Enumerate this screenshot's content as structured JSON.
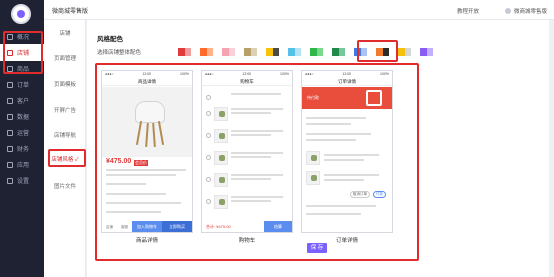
{
  "topbar": {
    "title": "微商城零售版",
    "help": "教程开放",
    "user": "微商城零售版"
  },
  "sidebar": {
    "items": [
      {
        "label": "概况"
      },
      {
        "label": "店铺"
      },
      {
        "label": "商品"
      },
      {
        "label": "订单"
      },
      {
        "label": "客户"
      },
      {
        "label": "数据"
      },
      {
        "label": "运营"
      },
      {
        "label": "财务"
      },
      {
        "label": "应用"
      },
      {
        "label": "设置"
      }
    ]
  },
  "subnav": {
    "items": [
      {
        "label": "店铺"
      },
      {
        "label": "页面管理"
      },
      {
        "label": "页面模板"
      },
      {
        "label": "开屏广告"
      },
      {
        "label": "店铺导航"
      },
      {
        "label": "店铺风格 ✓"
      },
      {
        "label": "图片文件"
      }
    ]
  },
  "style": {
    "section_title": "风格配色",
    "color_label": "选择店铺整体配色",
    "swatches": [
      {
        "left": "#e23b3b",
        "right": "#f29d9d"
      },
      {
        "left": "#ff6b2b",
        "right": "#ffb18a"
      },
      {
        "left": "#f5a3b1",
        "right": "#fbd0d8"
      },
      {
        "left": "#b7a06a",
        "right": "#ddd1b3"
      },
      {
        "left": "#f7c20a",
        "right": "#4a4a4a"
      },
      {
        "left": "#55c1e8",
        "right": "#b5e3f3"
      },
      {
        "left": "#2fb84a",
        "right": "#7ad88b"
      },
      {
        "left": "#1f8a4c",
        "right": "#76c79a"
      },
      {
        "left": "#3f7be0",
        "right": "#a9c3f2"
      },
      {
        "left": "#f07d2e",
        "right": "#2c2c2c"
      },
      {
        "left": "#f5c10f",
        "right": "#d6d6d6"
      },
      {
        "left": "#8a5cf6",
        "right": "#c4b0fa"
      }
    ]
  },
  "previews": [
    {
      "caption": "商品详情",
      "header": "商品详情"
    },
    {
      "caption": "购物车",
      "header": "购物车"
    },
    {
      "caption": "订单详情",
      "header": "订单详情"
    }
  ],
  "phone1": {
    "price": "¥475.00",
    "tag": "会员价",
    "btn_add": "加入购物车",
    "btn_buy": "立即购买",
    "icons": [
      "店铺",
      "客服",
      "购物车"
    ]
  },
  "phone2": {
    "total": "合计: ¥475.00",
    "btn": "结算"
  },
  "phone3": {
    "banner": "待付款",
    "btn_cancel": "取消订单",
    "btn_pay": "付款"
  },
  "save_label": "保 存"
}
